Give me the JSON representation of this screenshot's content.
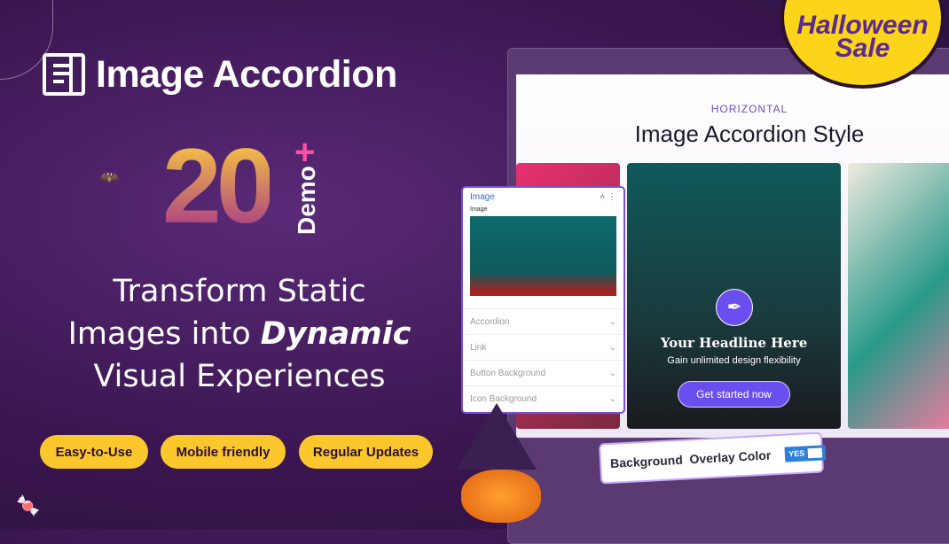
{
  "header": {
    "title": "Image Accordion",
    "logo_icon": "accordion-icon"
  },
  "badge": {
    "number": "20",
    "plus": "+",
    "label": "Demo"
  },
  "tagline": {
    "line1": "Transform Static",
    "line2_pre": "Images into ",
    "line2_em": "Dynamic",
    "line3": "Visual Experiences"
  },
  "features": [
    "Easy-to-Use",
    "Mobile friendly",
    "Regular Updates"
  ],
  "sale": {
    "line1": "Halloween",
    "line2": "Sale"
  },
  "preview": {
    "eyebrow": "HORIZONTAL",
    "title": "Image Accordion Style",
    "headline": "Your Headline Here",
    "subtext": "Gain unlimited design flexibility",
    "cta": "Get started now",
    "icon": "pen-nib-icon"
  },
  "panel": {
    "section": "Image",
    "field_label": "Image",
    "rows": [
      "Accordion",
      "Link",
      "Button Background",
      "Icon Background"
    ]
  },
  "overlay_toggle": {
    "label": "Background  Overlay Color",
    "value": "YES"
  },
  "colors": {
    "accent": "#6b4ef0",
    "pill": "#fcc72c",
    "background": "#3a1650"
  }
}
